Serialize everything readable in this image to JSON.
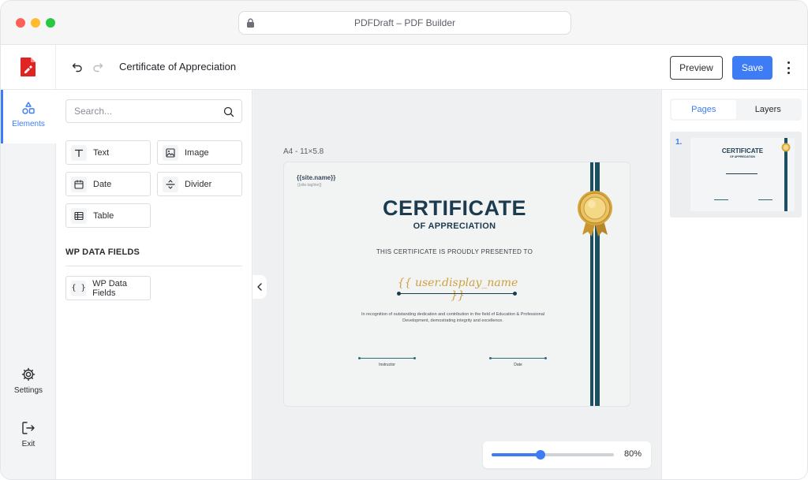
{
  "browser": {
    "url_title": "PDFDraft – PDF Builder"
  },
  "header": {
    "doc_title": "Certificate of Appreciation",
    "preview_label": "Preview",
    "save_label": "Save"
  },
  "rail": {
    "items": [
      {
        "label": "Elements",
        "icon": "shapes-icon"
      },
      {
        "label": "Settings",
        "icon": "gear-icon"
      },
      {
        "label": "Exit",
        "icon": "exit-icon"
      }
    ]
  },
  "elements_panel": {
    "search_placeholder": "Search...",
    "tools": [
      {
        "label": "Text",
        "icon": "text-icon"
      },
      {
        "label": "Image",
        "icon": "image-icon"
      },
      {
        "label": "Date",
        "icon": "calendar-icon"
      },
      {
        "label": "Divider",
        "icon": "divider-icon"
      },
      {
        "label": "Table",
        "icon": "table-icon"
      }
    ],
    "section_title": "WP DATA FIELDS",
    "data_fields_label": "WP Data Fields"
  },
  "canvas": {
    "page_label": "A4 - 11×5.8",
    "certificate": {
      "site_name": "{{site.name}}",
      "site_tagline": "{{site.tagline}}",
      "title": "CERTIFICATE",
      "subtitle": "OF APPRECIATION",
      "presented": "THIS CERTIFICATE IS PROUDLY PRESENTED TO",
      "recipient": "{{ user.display_name }}",
      "body": "In recognition of outstanding dedication and contribution in the field of Education & Professional Development, demostrating integrity and excellence.",
      "sig_left": "Instructor",
      "sig_right": "Date"
    },
    "zoom": {
      "value": 0.8,
      "label": "80%"
    }
  },
  "right_panel": {
    "tabs": [
      {
        "label": "Pages",
        "active": true
      },
      {
        "label": "Layers",
        "active": false
      }
    ],
    "page_number": "1.",
    "thumb_title": "CERTIFICATE",
    "thumb_subtitle": "OF APPRECIATION"
  },
  "colors": {
    "accent": "#3d7cf5",
    "cert_navy": "#1c3b4e",
    "gold": "#d0a040"
  }
}
